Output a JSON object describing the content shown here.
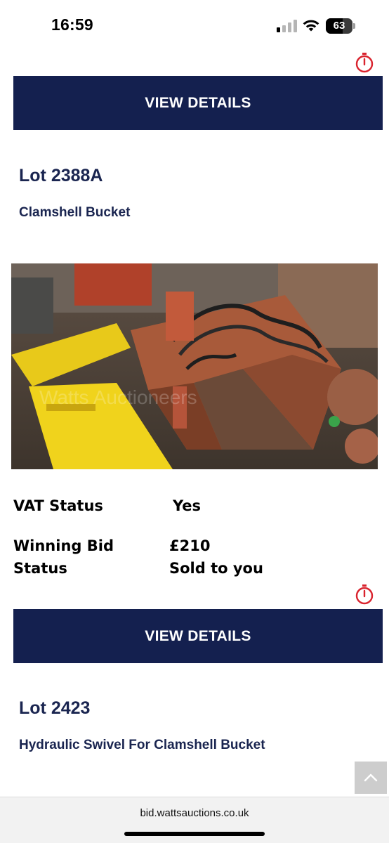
{
  "status_bar": {
    "time": "16:59",
    "battery_percent": "63",
    "battery_level": 0.63,
    "signal_bars_active": 1,
    "signal_bars_total": 4
  },
  "lots": [
    {
      "button_label": "VIEW DETAILS",
      "lot_title": "Lot 2388A",
      "description": "Clamshell Bucket"
    },
    {
      "button_label": "VIEW DETAILS",
      "lot_title": "Lot 2423",
      "description": "Hydraulic Swivel For Clamshell Bucket"
    }
  ],
  "photo": {
    "watermark": "Watts Auctioneers"
  },
  "info": {
    "vat_label": "VAT Status",
    "vat_value": "Yes",
    "winning_bid_label_line1": "Winning Bid",
    "winning_bid_label_line2": "Status",
    "winning_bid_value": "£210",
    "status_value": "Sold to you"
  },
  "browser": {
    "url": "bid.wattsauctions.co.uk"
  },
  "colors": {
    "navy": "#14204f",
    "timer_red": "#d9232e"
  },
  "icons": [
    "stopwatch-icon",
    "chevron-up-icon",
    "signal-icon",
    "wifi-icon",
    "battery-icon"
  ]
}
